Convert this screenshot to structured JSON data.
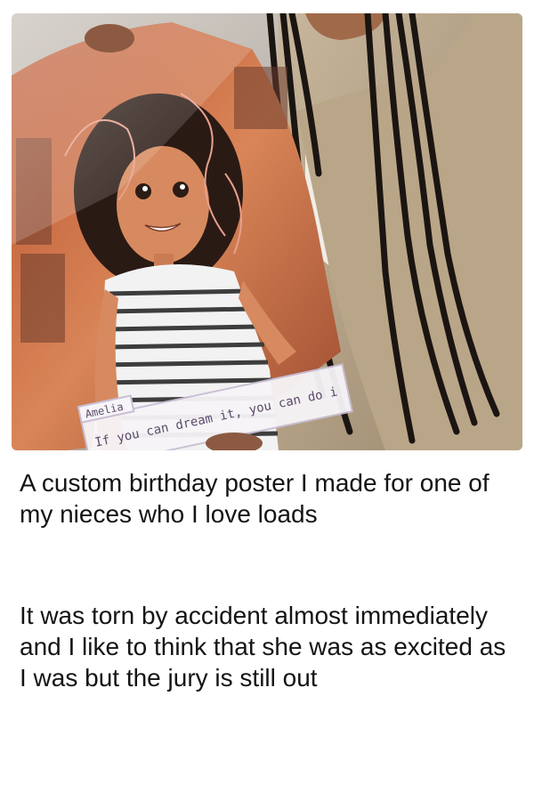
{
  "photo": {
    "icon": "poster-photo",
    "poster_name_tag": "Amelia",
    "poster_dialogue": "If you can dream it, you can do i"
  },
  "captions": [
    "A custom birthday poster I made for one of my nieces who I love loads",
    "It was torn by accident almost immediately and I like to think that she was as excited as I was but the jury is still out"
  ]
}
